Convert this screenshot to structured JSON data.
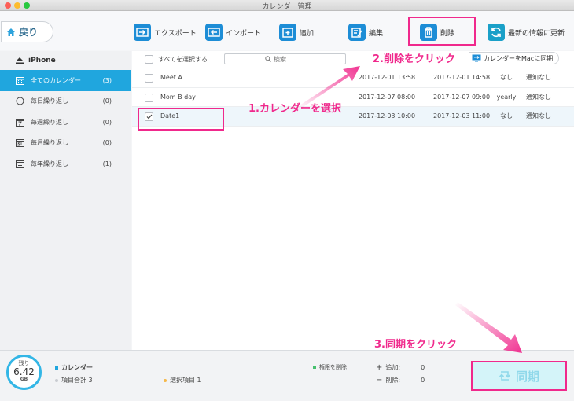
{
  "window": {
    "title": "カレンダー管理"
  },
  "toolbar": {
    "back_label": "戻り",
    "export_label": "エクスポート",
    "import_label": "インポート",
    "add_label": "追加",
    "edit_label": "編集",
    "delete_label": "削除",
    "refresh_label": "最新の情報に更新"
  },
  "sidebar": {
    "device": "iPhone",
    "items": [
      {
        "label": "全てのカレンダー",
        "count": "(3)",
        "icon": "calendar-icon"
      },
      {
        "label": "毎日繰り返し",
        "count": "(0)",
        "icon": "clock-icon"
      },
      {
        "label": "毎週繰り返し",
        "count": "(0)",
        "icon": "calendar-7-icon"
      },
      {
        "label": "毎月繰り返し",
        "count": "(0)",
        "icon": "calendar-31-icon"
      },
      {
        "label": "毎年繰り返し",
        "count": "(1)",
        "icon": "calendar-year-icon"
      }
    ]
  },
  "list": {
    "select_all_label": "すべてを選択する",
    "search_placeholder": "検索",
    "sync_to_mac_label": "カレンダーをMacに同期",
    "rows": [
      {
        "name": "Meet A",
        "start": "2017-12-01 13:58",
        "end": "2017-12-01 14:58",
        "repeat": "なし",
        "notification": "通知なし",
        "checked": false
      },
      {
        "name": "Mom  B day",
        "start": "2017-12-07 08:00",
        "end": "2017-12-07 09:00",
        "repeat": "yearly",
        "notification": "通知なし",
        "checked": false
      },
      {
        "name": "Date1",
        "start": "2017-12-03 10:00",
        "end": "2017-12-03 11:00",
        "repeat": "なし",
        "notification": "通知なし",
        "checked": true
      }
    ]
  },
  "status": {
    "storage_top": "残り",
    "storage_value": "6.42",
    "storage_unit": "GB",
    "category_label": "カレンダー",
    "total_label": "項目合計 3",
    "selected_label": "選択項目 1",
    "delete_permission_label": "権限を削除",
    "added_label": "追加:",
    "added_value": "0",
    "deleted_label": "削除:",
    "deleted_value": "0",
    "sync_label": "同期"
  },
  "annotations": {
    "step1": "1.カレンダーを選択",
    "step2": "2.削除をクリック",
    "step3": "3.同期をクリック"
  },
  "colors": {
    "accent": "#20a6de",
    "highlight": "#f0298c",
    "icon_blue": "#1d8dd6"
  }
}
